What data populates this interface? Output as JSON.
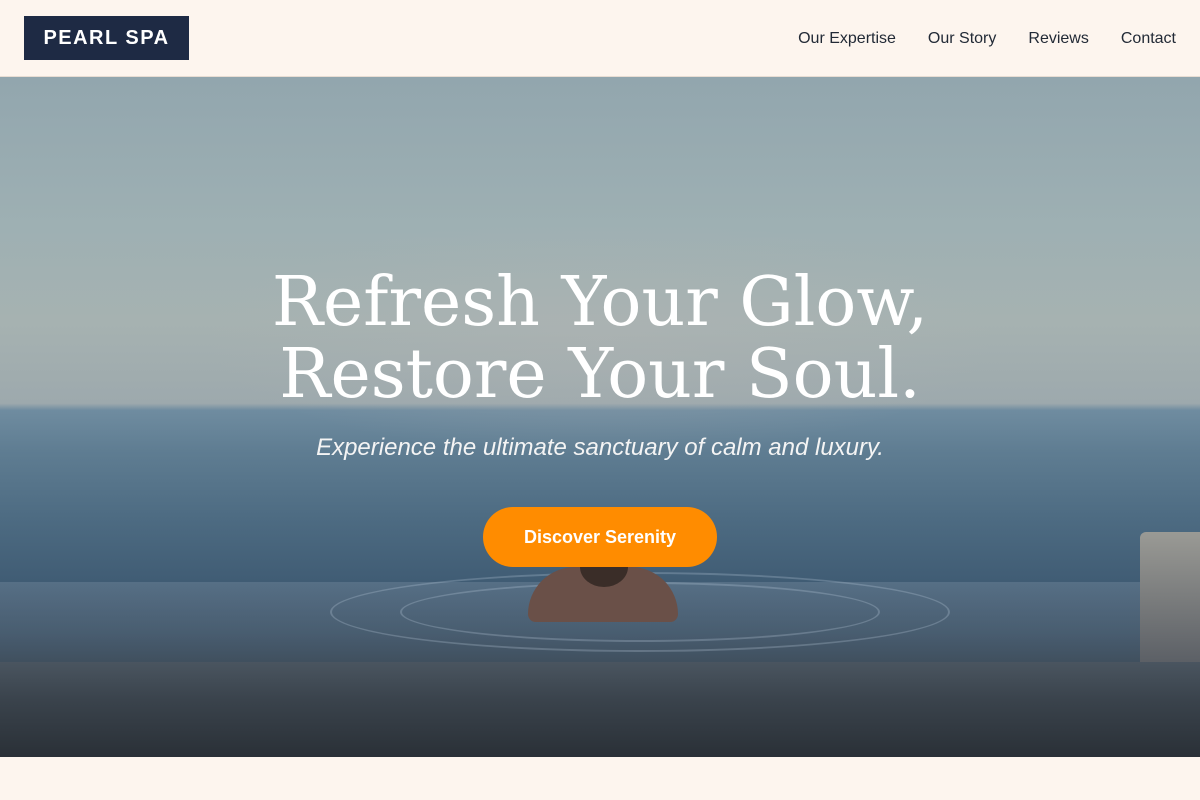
{
  "brand": {
    "name": "PEARL SPA",
    "color": "#1e2a44"
  },
  "nav": {
    "items": [
      {
        "label": "Our Expertise"
      },
      {
        "label": "Our Story"
      },
      {
        "label": "Reviews"
      },
      {
        "label": "Contact"
      }
    ]
  },
  "hero": {
    "title_line1": "Refresh Your Glow,",
    "title_line2": "Restore Your Soul.",
    "subtitle": "Experience the ultimate sanctuary of calm and luxury.",
    "cta_label": "Discover Serenity",
    "cta_color": "#ff8c00",
    "image": "infinity-pool-sea-view"
  },
  "page": {
    "background": "#fdf5ee"
  }
}
